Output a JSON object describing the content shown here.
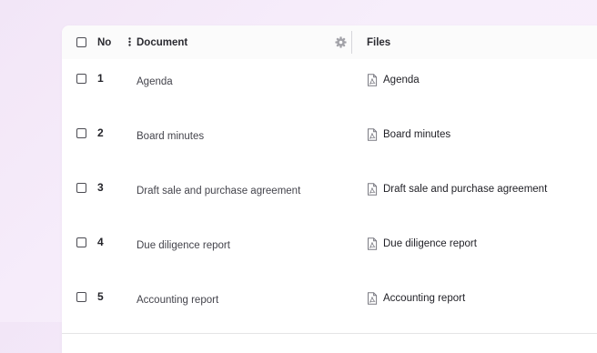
{
  "table": {
    "headers": {
      "no": "No",
      "document": "Document",
      "files": "Files"
    },
    "rows": [
      {
        "no": "1",
        "document": "Agenda",
        "file": "Agenda"
      },
      {
        "no": "2",
        "document": "Board minutes",
        "file": "Board minutes"
      },
      {
        "no": "3",
        "document": "Draft sale and purchase agreement",
        "file": "Draft sale and purchase agreement"
      },
      {
        "no": "4",
        "document": "Due diligence report",
        "file": "Due diligence report"
      },
      {
        "no": "5",
        "document": "Accounting report",
        "file": "Accounting report"
      }
    ]
  },
  "icons": {
    "sort": "drag-sort-icon",
    "settings": "gear-icon",
    "file": "pdf-file-icon"
  },
  "colors": {
    "background": "#f5ebf9",
    "text": "#24242a",
    "divider": "#e4e4e6"
  }
}
